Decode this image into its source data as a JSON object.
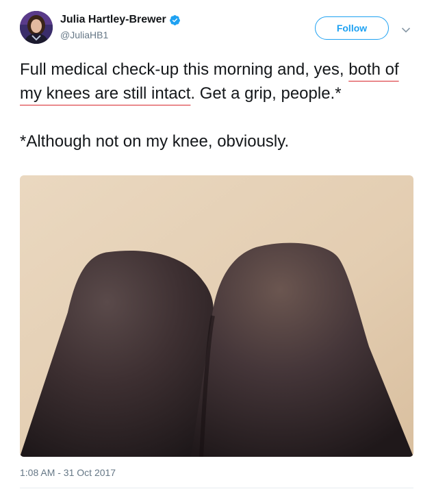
{
  "author": {
    "display_name": "Julia Hartley-Brewer",
    "handle": "@JuliaHB1",
    "verified": true,
    "avatar_icon": "profile-photo"
  },
  "follow_button": {
    "label": "Follow"
  },
  "more_menu": {
    "icon": "chevron-down-icon"
  },
  "tweet": {
    "line1_before": "Full medical check-up this morning and, yes, ",
    "underlined": "both of my knees are still intact",
    "line1_after": ". Get a grip, people.*",
    "footnote": "*Although not on my knee, obviously."
  },
  "media": {
    "kind": "photo",
    "subject": "knees-in-black-tights"
  },
  "timestamp": "1:08 AM - 31 Oct 2017",
  "colors": {
    "accent": "#1da1f2",
    "text": "#14171a",
    "secondary_text": "#657786",
    "underline": "#d8262b"
  }
}
